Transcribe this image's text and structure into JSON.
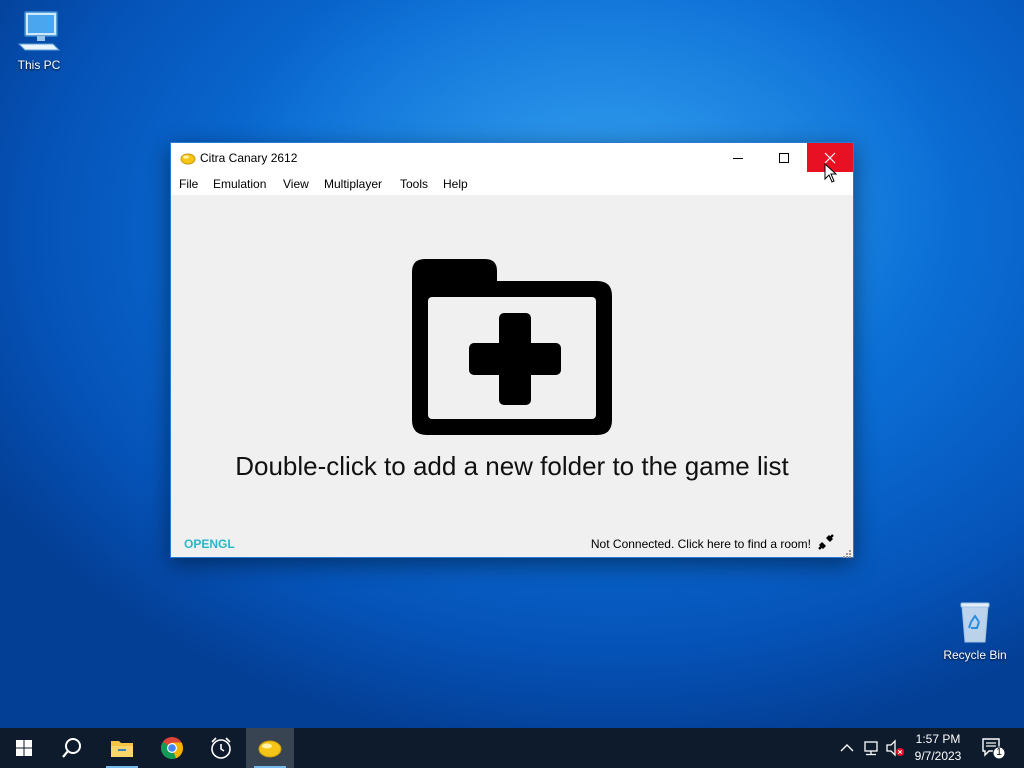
{
  "desktop": {
    "icons": [
      {
        "label": "This PC"
      },
      {
        "label": "Recycle Bin"
      }
    ]
  },
  "window": {
    "title": "Citra Canary 2612",
    "menu": [
      "File",
      "Emulation",
      "View",
      "Multiplayer",
      "Tools",
      "Help"
    ],
    "empty_hint": "Double-click to add a new folder to the game list",
    "status": {
      "renderer": "OPENGL",
      "network": "Not Connected. Click here to find a room!"
    }
  },
  "taskbar": {
    "apps": [
      "start-icon",
      "search-icon",
      "file-explorer-icon",
      "chrome-icon",
      "alarms-clock-icon",
      "citra-icon"
    ],
    "tray": {
      "time": "1:57 PM",
      "date": "9/7/2023",
      "notification_count": "1"
    }
  },
  "colors": {
    "close_button": "#e81123",
    "renderer_label": "#28b8c8",
    "taskbar": "#0d1b2d"
  }
}
